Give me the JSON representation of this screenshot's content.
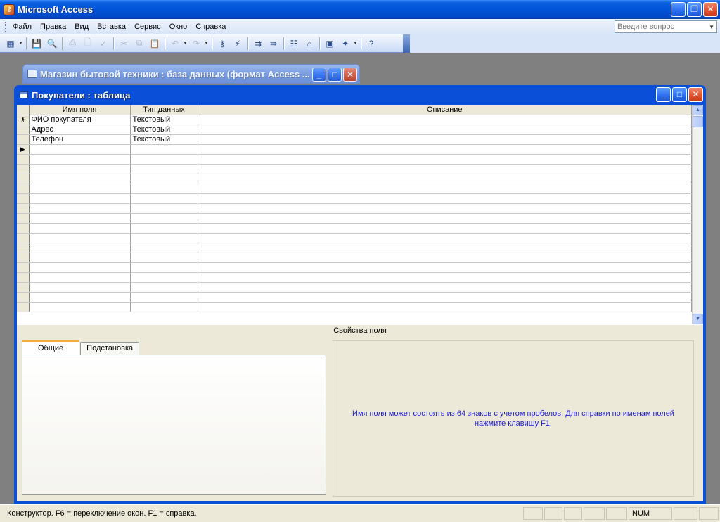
{
  "app": {
    "title": "Microsoft Access",
    "icon_label": "⚷"
  },
  "menu": [
    {
      "label": "Файл"
    },
    {
      "label": "Правка"
    },
    {
      "label": "Вид"
    },
    {
      "label": "Вставка"
    },
    {
      "label": "Сервис"
    },
    {
      "label": "Окно"
    },
    {
      "label": "Справка"
    }
  ],
  "ask": {
    "placeholder": "Введите вопрос"
  },
  "db_window": {
    "title": "Магазин бытовой техники : база данных (формат Access ..."
  },
  "table_window": {
    "title": "Покупатели : таблица",
    "columns": [
      "Имя поля",
      "Тип данных",
      "Описание"
    ],
    "rows": [
      {
        "name": "ФИО покупателя",
        "type": "Текстовый",
        "description": "",
        "key": true
      },
      {
        "name": "Адрес",
        "type": "Текстовый",
        "description": "",
        "key": false
      },
      {
        "name": "Телефон",
        "type": "Текстовый",
        "description": "",
        "key": false
      }
    ],
    "props_caption": "Свойства поля",
    "tabs": [
      {
        "label": "Общие",
        "active": true
      },
      {
        "label": "Подстановка",
        "active": false
      }
    ],
    "help_text": "Имя поля может состоять из 64 знаков с учетом пробелов.  Для справки по именам полей нажмите клавишу F1."
  },
  "status": {
    "text": "Конструктор.  F6 = переключение окон.  F1 = справка.",
    "num": "NUM"
  },
  "colors": {
    "title_blue": "#0052d6",
    "help_text": "#1d1dd6",
    "face": "#ece9d8"
  }
}
